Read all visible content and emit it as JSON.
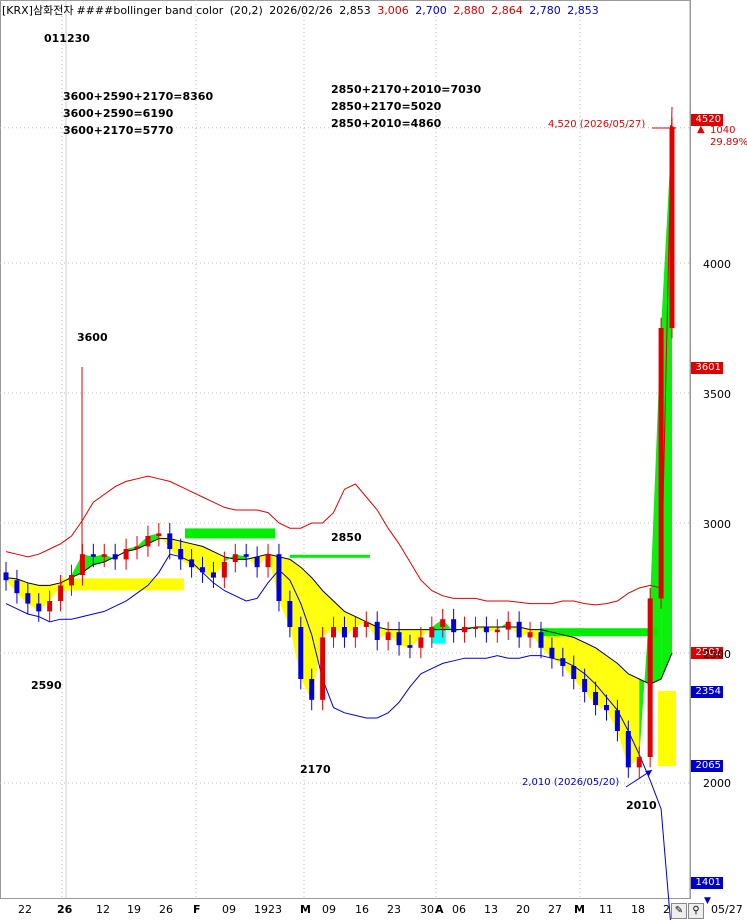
{
  "legend": {
    "symbol": "[KRX]삼화전자",
    "indicator": "####bollinger band color",
    "params": "(20,2)",
    "date": "2026/02/26",
    "open": "2,853",
    "high": "3,006",
    "low": "2,700",
    "close1": "2,880",
    "v1": "2,864",
    "v2": "2,780",
    "v3": "2,853"
  },
  "annotations": {
    "code": "011230",
    "sum_left": "3600+2590+2170=8360\n3600+2590=6190\n3600+2170=5770",
    "sum_right": "2850+2170+2010=7030\n2850+2170=5020\n2850+2010=4860",
    "l3600": "3600",
    "l2590": "2590",
    "l2170": "2170",
    "l2850": "2850",
    "l2010": "2010"
  },
  "markers": {
    "high_label": "4,520 (2026/05/27)",
    "low_label": "2,010 (2026/05/20)",
    "change": "1040",
    "change_pct": "29.89%"
  },
  "price_tags": {
    "last": "4520",
    "upper": "3601",
    "mid": "2501",
    "lower_a": "2354",
    "lower_b": "2065",
    "bottom": "1401"
  },
  "axis": {
    "y_ticks": [
      "4000",
      "3500",
      "3000",
      "2500",
      "2000"
    ],
    "x_ticks": [
      "22",
      "26",
      "12",
      "19",
      "26",
      "F",
      "09",
      "1923",
      "M",
      "09",
      "16",
      "23",
      "30",
      "A",
      "06",
      "13",
      "20",
      "27",
      "M",
      "11",
      "18",
      "2"
    ],
    "x_end": "05/27"
  },
  "colors": {
    "up": "#e00000",
    "down": "#0000dd",
    "upper_band": "#e00000",
    "lower_band": "#0000cc",
    "mid_band": "#000000",
    "fill_green": "#00ee00",
    "fill_yellow": "#ffff00",
    "fill_cyan": "#00ffff"
  },
  "chart_data": {
    "type": "candlestick",
    "title": "[KRX]삼화전자 ####bollinger band color (20,2)",
    "ylim": [
      1400,
      4900
    ],
    "y_ticks": [
      2000,
      2500,
      3000,
      3500,
      4000
    ],
    "series": [
      {
        "name": "upper_band",
        "values": [
          2890,
          2880,
          2870,
          2880,
          2900,
          2920,
          2950,
          3010,
          3080,
          3110,
          3140,
          3160,
          3170,
          3180,
          3170,
          3160,
          3140,
          3120,
          3100,
          3080,
          3060,
          3050,
          3050,
          3050,
          3040,
          3000,
          2980,
          2980,
          3000,
          3000,
          3040,
          3130,
          3150,
          3100,
          3050,
          2980,
          2920,
          2850,
          2780,
          2740,
          2720,
          2710,
          2710,
          2710,
          2700,
          2700,
          2700,
          2695,
          2690,
          2690,
          2690,
          2700,
          2700,
          2690,
          2685,
          2690,
          2700,
          2730,
          2750,
          2760,
          2750,
          4600
        ]
      },
      {
        "name": "middle_band",
        "values": [
          2790,
          2785,
          2770,
          2760,
          2760,
          2770,
          2790,
          2810,
          2840,
          2850,
          2870,
          2890,
          2900,
          2920,
          2940,
          2940,
          2930,
          2920,
          2910,
          2890,
          2870,
          2860,
          2860,
          2870,
          2880,
          2870,
          2860,
          2830,
          2790,
          2740,
          2700,
          2660,
          2640,
          2620,
          2600,
          2590,
          2590,
          2590,
          2590,
          2590,
          2590,
          2590,
          2590,
          2600,
          2600,
          2600,
          2600,
          2600,
          2590,
          2590,
          2580,
          2570,
          2560,
          2540,
          2520,
          2490,
          2460,
          2420,
          2400,
          2380,
          2400,
          2500
        ]
      },
      {
        "name": "lower_band",
        "values": [
          2690,
          2670,
          2650,
          2640,
          2620,
          2630,
          2630,
          2640,
          2650,
          2660,
          2680,
          2700,
          2730,
          2760,
          2810,
          2880,
          2870,
          2850,
          2810,
          2770,
          2740,
          2720,
          2700,
          2710,
          2770,
          2820,
          2780,
          2690,
          2570,
          2400,
          2290,
          2270,
          2260,
          2250,
          2250,
          2270,
          2310,
          2370,
          2420,
          2440,
          2460,
          2470,
          2480,
          2480,
          2480,
          2490,
          2480,
          2480,
          2490,
          2490,
          2480,
          2470,
          2450,
          2420,
          2380,
          2330,
          2280,
          2200,
          2110,
          2010,
          1900,
          1400
        ]
      },
      {
        "name": "close",
        "values": [
          2780,
          2730,
          2690,
          2660,
          2700,
          2760,
          2800,
          2880,
          2870,
          2880,
          2860,
          2900,
          2910,
          2950,
          2960,
          2900,
          2860,
          2830,
          2810,
          2790,
          2850,
          2880,
          2870,
          2830,
          2880,
          2700,
          2600,
          2400,
          2320,
          2560,
          2600,
          2560,
          2600,
          2620,
          2550,
          2580,
          2530,
          2520,
          2560,
          2600,
          2630,
          2580,
          2600,
          2600,
          2580,
          2590,
          2620,
          2560,
          2580,
          2520,
          2480,
          2450,
          2400,
          2350,
          2300,
          2280,
          2200,
          2060,
          2100,
          2710,
          3750,
          4520
        ]
      }
    ],
    "annotations": [
      "3600",
      "2590",
      "2170",
      "2850",
      "2010"
    ],
    "x_labels": [
      "22",
      "26",
      "12",
      "19",
      "26",
      "F",
      "09",
      "1923",
      "M",
      "09",
      "16",
      "23",
      "30",
      "A",
      "06",
      "13",
      "20",
      "27",
      "M",
      "11",
      "18",
      "2"
    ],
    "high": {
      "value": 4520,
      "date": "2026/05/27"
    },
    "low": {
      "value": 2010,
      "date": "2026/05/20"
    }
  }
}
